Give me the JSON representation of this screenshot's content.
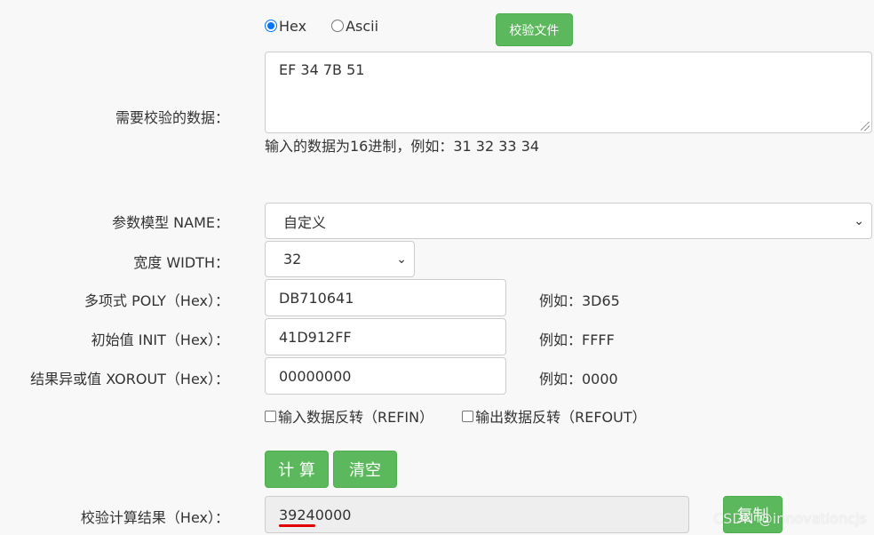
{
  "input_mode": {
    "options": [
      "Hex",
      "Ascii"
    ],
    "selected": "Hex"
  },
  "verify_file_button": "校验文件",
  "data_field": {
    "label": "需要校验的数据：",
    "value": "EF 34 7B 51",
    "hint": "输入的数据为16进制，例如：31 32 33 34"
  },
  "model": {
    "label": "参数模型 NAME：",
    "value": "自定义"
  },
  "width": {
    "label": "宽度 WIDTH：",
    "value": "32"
  },
  "poly": {
    "label": "多项式 POLY（Hex）：",
    "value": "DB710641",
    "example": "例如：3D65"
  },
  "init": {
    "label": "初始值 INIT（Hex）：",
    "value": "41D912FF",
    "example": "例如：FFFF"
  },
  "xorout": {
    "label": "结果异或值 XOROUT（Hex）：",
    "value": "00000000",
    "example": "例如：0000"
  },
  "refin": {
    "label": "输入数据反转（REFIN）",
    "checked": false
  },
  "refout": {
    "label": "输出数据反转（REFOUT）",
    "checked": false
  },
  "buttons": {
    "calculate": "计 算",
    "clear": "清空",
    "copy": "复制"
  },
  "result": {
    "label": "校验计算结果（Hex）：",
    "value": "39240000"
  },
  "watermark": "CSDN @innovationcjs",
  "colors": {
    "accent_green": "#5cb85c",
    "radio_blue": "#0075ff",
    "underline_red": "#e00000"
  }
}
